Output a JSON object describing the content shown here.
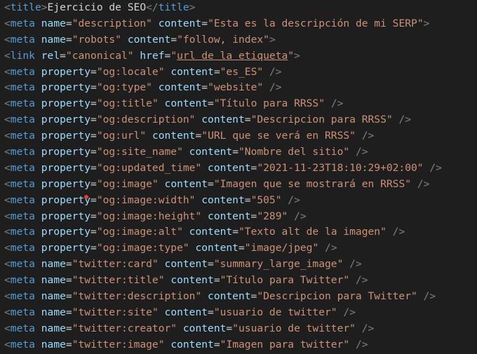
{
  "theme": {
    "background": "#1e1e1e",
    "tag_color": "#569cd6",
    "attr_color": "#9cdcfe",
    "value_color": "#ce9178",
    "bracket_color": "#808080",
    "text_color": "#d4d4d4",
    "cursor_color": "#e8393c"
  },
  "lines": [
    {
      "tag": "title",
      "text": "Ejercicio de SEO",
      "closing": "title"
    },
    {
      "tag": "meta",
      "attrs": [
        {
          "name": "name",
          "value": "description"
        },
        {
          "name": "content",
          "value": "Esta es la descripción de mi SERP"
        }
      ],
      "end": ">"
    },
    {
      "tag": "meta",
      "attrs": [
        {
          "name": "name",
          "value": "robots"
        },
        {
          "name": "content",
          "value": "follow, index"
        }
      ],
      "end": ">"
    },
    {
      "tag": "link",
      "attrs": [
        {
          "name": "rel",
          "value": "canonical"
        },
        {
          "name": "href",
          "value": "url de la etiqueta",
          "underline": true
        }
      ],
      "end": ">"
    },
    {
      "tag": "meta",
      "attrs": [
        {
          "name": "property",
          "value": "og:locale"
        },
        {
          "name": "content",
          "value": "es_ES"
        }
      ],
      "end": " />"
    },
    {
      "tag": "meta",
      "attrs": [
        {
          "name": "property",
          "value": "og:type"
        },
        {
          "name": "content",
          "value": "website"
        }
      ],
      "end": " />"
    },
    {
      "tag": "meta",
      "attrs": [
        {
          "name": "property",
          "value": "og:title"
        },
        {
          "name": "content",
          "value": "Título para RRSS"
        }
      ],
      "end": " />"
    },
    {
      "tag": "meta",
      "attrs": [
        {
          "name": "property",
          "value": "og:description"
        },
        {
          "name": "content",
          "value": "Descripcion para RRSS"
        }
      ],
      "end": " />"
    },
    {
      "tag": "meta",
      "attrs": [
        {
          "name": "property",
          "value": "og:url"
        },
        {
          "name": "content",
          "value": "URL que se verá en RRSS"
        }
      ],
      "end": " />"
    },
    {
      "tag": "meta",
      "attrs": [
        {
          "name": "property",
          "value": "og:site_name"
        },
        {
          "name": "content",
          "value": "Nombre del sitio"
        }
      ],
      "end": " />"
    },
    {
      "tag": "meta",
      "attrs": [
        {
          "name": "property",
          "value": "og:updated_time"
        },
        {
          "name": "content",
          "value": "2021-11-23T18:10:29+02:00"
        }
      ],
      "end": " />"
    },
    {
      "tag": "meta",
      "attrs": [
        {
          "name": "property",
          "value": "og:image"
        },
        {
          "name": "content",
          "value": "Imagen que se mostrará en RRSS"
        }
      ],
      "end": " />"
    },
    {
      "tag": "meta",
      "attrs": [
        {
          "name": "property",
          "value": "og:image:width"
        },
        {
          "name": "content",
          "value": "505"
        }
      ],
      "end": " />"
    },
    {
      "tag": "meta",
      "attrs": [
        {
          "name": "property",
          "value": "og:image:height"
        },
        {
          "name": "content",
          "value": "289"
        }
      ],
      "end": " />"
    },
    {
      "tag": "meta",
      "attrs": [
        {
          "name": "property",
          "value": "og:image:alt"
        },
        {
          "name": "content",
          "value": "Texto alt de la imagen"
        }
      ],
      "end": " />"
    },
    {
      "tag": "meta",
      "attrs": [
        {
          "name": "property",
          "value": "og:image:type"
        },
        {
          "name": "content",
          "value": "image/jpeg"
        }
      ],
      "end": " />"
    },
    {
      "tag": "meta",
      "attrs": [
        {
          "name": "name",
          "value": "twitter:card"
        },
        {
          "name": "content",
          "value": "summary_large_image"
        }
      ],
      "end": " />"
    },
    {
      "tag": "meta",
      "attrs": [
        {
          "name": "name",
          "value": "twitter:title"
        },
        {
          "name": "content",
          "value": "Título para Twitter"
        }
      ],
      "end": " />"
    },
    {
      "tag": "meta",
      "attrs": [
        {
          "name": "name",
          "value": "twitter:description"
        },
        {
          "name": "content",
          "value": "Descripcion para Twitter"
        }
      ],
      "end": " />"
    },
    {
      "tag": "meta",
      "attrs": [
        {
          "name": "name",
          "value": "twitter:site"
        },
        {
          "name": "content",
          "value": "usuario de twitter"
        }
      ],
      "end": " />"
    },
    {
      "tag": "meta",
      "attrs": [
        {
          "name": "name",
          "value": "twitter:creator"
        },
        {
          "name": "content",
          "value": "usuario de twitter"
        }
      ],
      "end": " />"
    },
    {
      "tag": "meta",
      "attrs": [
        {
          "name": "name",
          "value": "twitter:image"
        },
        {
          "name": "content",
          "value": "Imagen para twitter"
        }
      ],
      "end": " />"
    }
  ]
}
